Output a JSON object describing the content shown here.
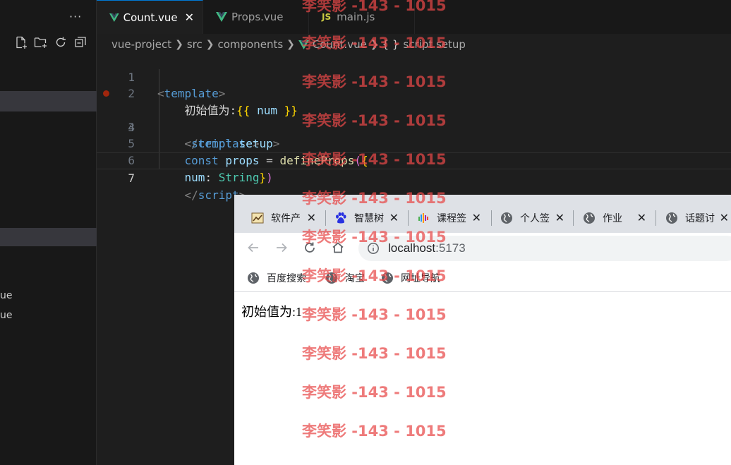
{
  "editor": {
    "tabs": [
      {
        "label": "Count.vue",
        "icon": "vue-icon",
        "active": true,
        "close": "✕"
      },
      {
        "label": "Props.vue",
        "icon": "vue-icon",
        "active": false
      },
      {
        "label": "main.js",
        "icon": "js-icon",
        "icon_text": "JS",
        "active": false
      }
    ],
    "breadcrumb": [
      "vue-project",
      "src",
      "components",
      "Count.vue",
      "script setup"
    ],
    "breadcrumb_brace": "{ }",
    "lines": [
      {
        "num": "1"
      },
      {
        "num": "2"
      },
      {
        "num": "3"
      },
      {
        "num": "4"
      },
      {
        "num": "5"
      },
      {
        "num": "6"
      },
      {
        "num": "7"
      }
    ],
    "code": {
      "l1_tag": "template",
      "l2_text": "初始值为:",
      "l2_open": "{{",
      "l2_var": "num",
      "l2_close": "}}",
      "l3_tag": "template",
      "l4_tag": "script",
      "l4_attr": "setup",
      "l5_kw": "const",
      "l5_var": "props",
      "l5_eq": "=",
      "l5_fn": "defineProps",
      "l6_prop": "num",
      "l6_type": "String",
      "l7_tag": "script"
    }
  },
  "sidebar": {
    "more": "···",
    "files": [
      "ue",
      "ue"
    ]
  },
  "browser": {
    "tabs": [
      {
        "label": "软件产",
        "icon": "software-favicon"
      },
      {
        "label": "智慧树",
        "icon": "baidu-paw-icon"
      },
      {
        "label": "课程签",
        "icon": "course-favicon"
      },
      {
        "label": "个人签",
        "icon": "globe-icon"
      },
      {
        "label": "作业",
        "icon": "globe-icon"
      },
      {
        "label": "话题讨",
        "icon": "globe-icon"
      }
    ],
    "tab_close": "✕",
    "url_host": "localhost",
    "url_port": ":5173",
    "bookmarks": [
      "百度搜索",
      "淘宝",
      "网址导航"
    ],
    "page_text": "初始值为:1"
  },
  "watermark": "李笑影 -143 - 1015",
  "colors": {
    "vue_green": "#41b883",
    "breakpoint": "#a1260d",
    "watermark": "#e84848"
  }
}
